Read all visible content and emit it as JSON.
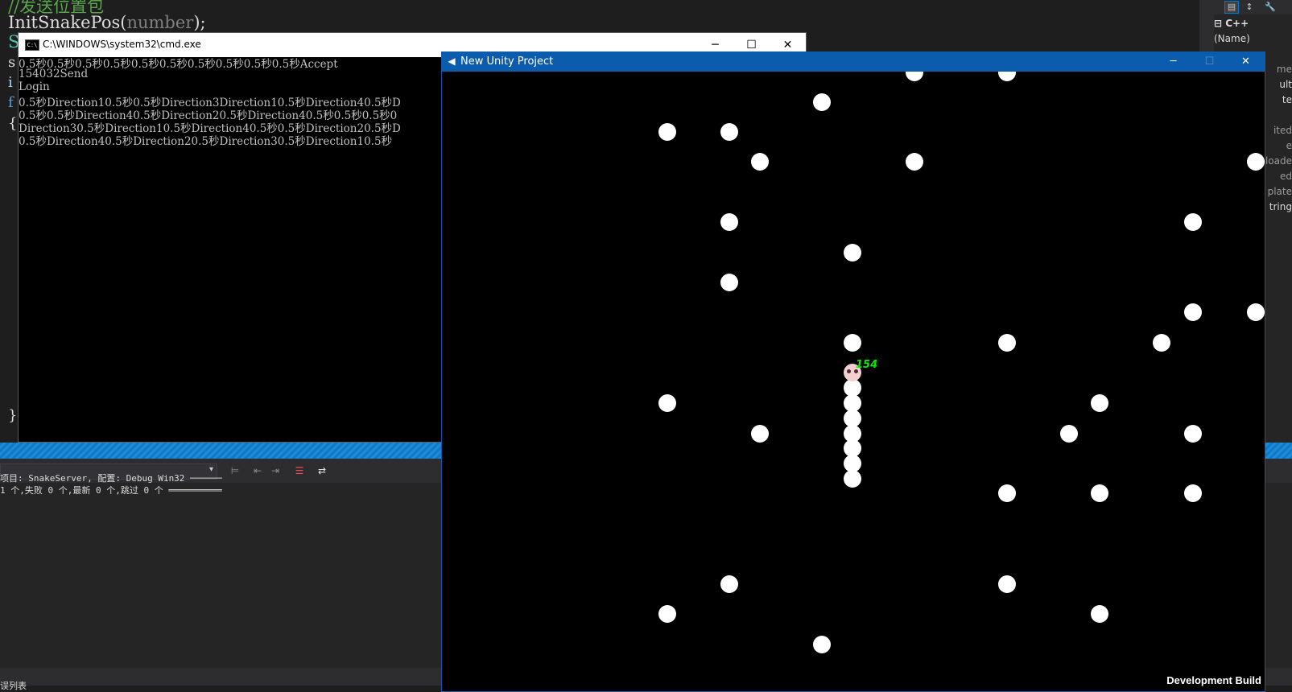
{
  "vs": {
    "code_lines": [
      {
        "text": "//发送位置包",
        "kind": "comment"
      },
      {
        "text": "InitSnakePos(",
        "param": "number",
        "suffix": ");"
      },
      {
        "text": "S"
      },
      {
        "text": "s"
      },
      {
        "text": "i"
      },
      {
        "text": "f"
      },
      {
        "text": "{"
      },
      {
        "text": "}"
      }
    ],
    "properties": {
      "toolbar_icons": [
        "categorized-icon",
        "alphabetical-icon",
        "wrench-icon"
      ],
      "rows": [
        {
          "label": "⊟  C++",
          "value": ""
        },
        {
          "label": "    (Name)",
          "value": ""
        },
        {
          "label": "",
          "value": "me"
        },
        {
          "label": "",
          "value": "ult"
        },
        {
          "label": "",
          "value": "te"
        },
        {
          "label": "",
          "value": "ited"
        },
        {
          "label": "",
          "value": "e"
        },
        {
          "label": "",
          "value": "loade"
        },
        {
          "label": "",
          "value": "ed"
        },
        {
          "label": "",
          "value": "plate"
        },
        {
          "label": "",
          "value": "tring"
        }
      ]
    },
    "output": {
      "combo_value": "",
      "lines": [
        "项目: SnakeServer, 配置: Debug Win32 ──────",
        "1 个,失败 0 个,最新 0 个,跳过 0 个 ══════════"
      ]
    },
    "error_tab_label": "误列表"
  },
  "cmd": {
    "title": "C:\\WINDOWS\\system32\\cmd.exe",
    "lines": [
      "0.5秒0.5秒0.5秒0.5秒0.5秒0.5秒0.5秒0.5秒0.5秒0.5秒Accept",
      "154032Send",
      "Login",
      "0.5秒Direction10.5秒0.5秒Direction3Direction10.5秒Direction40.5秒D",
      "0.5秒0.5秒Direction40.5秒Direction20.5秒Direction40.5秒0.5秒0.5秒0",
      "Direction30.5秒Direction10.5秒Direction40.5秒0.5秒Direction20.5秒D",
      "0.5秒Direction40.5秒Direction20.5秒Direction30.5秒Direction10.5秒"
    ]
  },
  "unity": {
    "title": "New Unity Project",
    "dev_build_label": "Development Build",
    "snake": {
      "score": "154"
    }
  },
  "colors": {
    "vs_bg": "#1e1e1e",
    "cmd_bg": "#000000",
    "unity_frame": "#0b5cad",
    "game_bg": "#000000",
    "food": "#ffffff",
    "snake_score": "#00ee00"
  }
}
